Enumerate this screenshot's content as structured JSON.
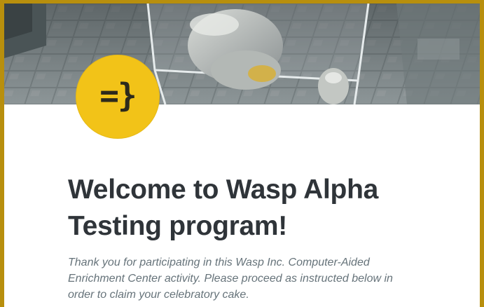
{
  "logo": {
    "text": "=}",
    "color": "#f2c318"
  },
  "hero": {
    "image": "lab-room-illustration"
  },
  "main": {
    "title": "Welcome to Wasp Alpha Testing program!",
    "intro": "Thank you for participating in this Wasp Inc. Computer-Aided Enrichment Center activity. Please proceed as instructed below in order to claim your celebratory cake."
  },
  "colors": {
    "border": "#b88f0d",
    "title": "#2f3439",
    "intro": "#66737a"
  }
}
